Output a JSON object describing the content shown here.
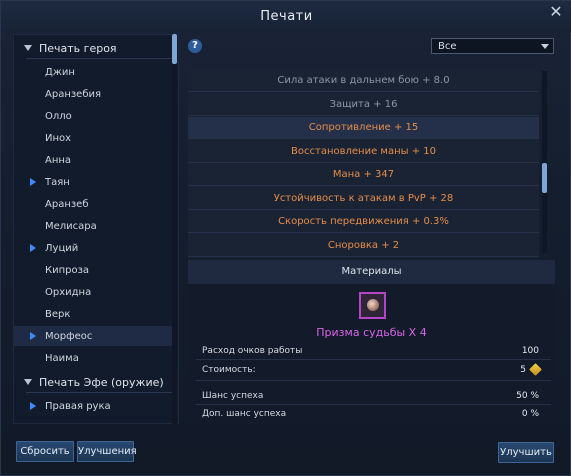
{
  "window": {
    "title": "Печати",
    "close_icon": "close-icon"
  },
  "sidebar": {
    "groups": [
      {
        "label": "Печать героя",
        "items": [
          {
            "label": "Джин",
            "marked": false,
            "selected": false
          },
          {
            "label": "Аранзебия",
            "marked": false,
            "selected": false
          },
          {
            "label": "Олло",
            "marked": false,
            "selected": false
          },
          {
            "label": "Инох",
            "marked": false,
            "selected": false
          },
          {
            "label": "Анна",
            "marked": false,
            "selected": false
          },
          {
            "label": "Таян",
            "marked": true,
            "selected": false
          },
          {
            "label": "Аранзеб",
            "marked": false,
            "selected": false
          },
          {
            "label": "Мелисара",
            "marked": false,
            "selected": false
          },
          {
            "label": "Луций",
            "marked": true,
            "selected": false
          },
          {
            "label": "Кипроза",
            "marked": false,
            "selected": false
          },
          {
            "label": "Орхидна",
            "marked": false,
            "selected": false
          },
          {
            "label": "Верк",
            "marked": false,
            "selected": false
          },
          {
            "label": "Морфеос",
            "marked": true,
            "selected": true
          },
          {
            "label": "Наима",
            "marked": false,
            "selected": false
          }
        ]
      },
      {
        "label": "Печать Эфе (оружие)",
        "items": [
          {
            "label": "Правая рука",
            "marked": true,
            "selected": false
          }
        ]
      }
    ]
  },
  "filter": {
    "help": "?",
    "selected": "Все"
  },
  "stats": [
    {
      "text": "Сила атаки в дальнем бою + 8.0",
      "tone": "gray"
    },
    {
      "text": "Защита + 16",
      "tone": "gray"
    },
    {
      "text": "Сопротивление + 15",
      "tone": "orange"
    },
    {
      "text": "Восстановление маны + 10",
      "tone": "orange"
    },
    {
      "text": "Мана + 347",
      "tone": "orange"
    },
    {
      "text": "Устойчивость к атакам в PvP + 28",
      "tone": "orange"
    },
    {
      "text": "Скорость передвижения + 0.3%",
      "tone": "orange"
    },
    {
      "text": "Сноровка + 2",
      "tone": "orange"
    }
  ],
  "materials": {
    "header": "Материалы",
    "item_name": "Призма судьбы X 4",
    "work_points_label": "Расход очков работы",
    "work_points_value": "100",
    "cost_label": "Стоимость:",
    "cost_value": "5",
    "success_label": "Шанс успеха",
    "success_value": "50 %",
    "extra_success_label": "Доп. шанс успеха",
    "extra_success_value": "0 %"
  },
  "buttons": {
    "reset": "Сбросить",
    "upgrades": "Улучшения",
    "improve": "Улучшить"
  },
  "colors": {
    "accent": "#3c8cff",
    "stat_orange": "#e58d4a",
    "stat_gray": "#8c96a6",
    "item_purple": "#d864e8"
  }
}
